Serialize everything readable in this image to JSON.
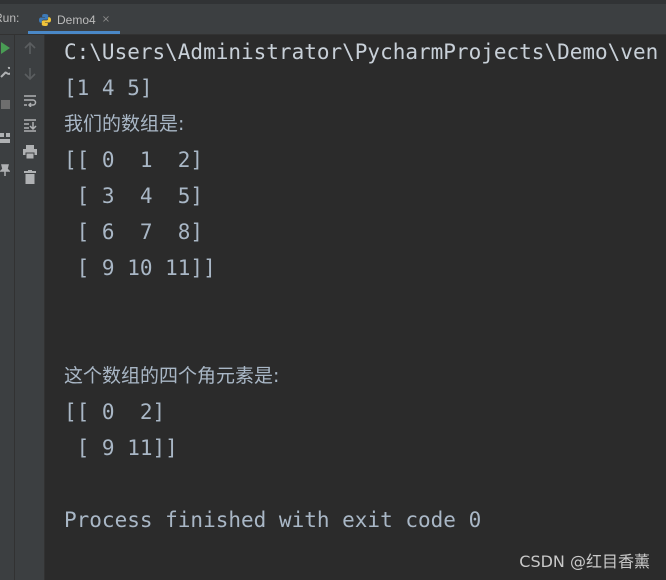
{
  "run_panel": {
    "label": "Run:",
    "tab": {
      "label": "Demo4",
      "close": "×",
      "icon": "python-icon"
    }
  },
  "toolbar": {
    "outer": [
      "rerun-icon",
      "wrench-icon",
      "stop-icon",
      "layout-icon",
      "pin-icon"
    ],
    "inner": [
      "up-arrow-icon",
      "down-arrow-icon",
      "soft-wrap-icon",
      "scroll-to-end-icon",
      "print-icon",
      "trash-icon"
    ]
  },
  "console": {
    "lines": {
      "path": "C:\\Users\\Administrator\\PycharmProjects\\Demo\\ven",
      "l1": "[1 4 5]",
      "l2": "我们的数组是:",
      "l3": "[[ 0  1  2]",
      "l4": " [ 3  4  5]",
      "l5": " [ 6  7  8]",
      "l6": " [ 9 10 11]]",
      "l7": "这个数组的四个角元素是:",
      "l8": "[[ 0  2]",
      "l9": " [ 9 11]]",
      "l10": "Process finished with exit code 0"
    }
  },
  "watermark": "CSDN @红目香薰",
  "colors": {
    "background": "#2b2b2b",
    "panel": "#3c3f41",
    "text": "#a9b7c6",
    "accent": "#4a88c7",
    "run_green": "#499c54"
  }
}
